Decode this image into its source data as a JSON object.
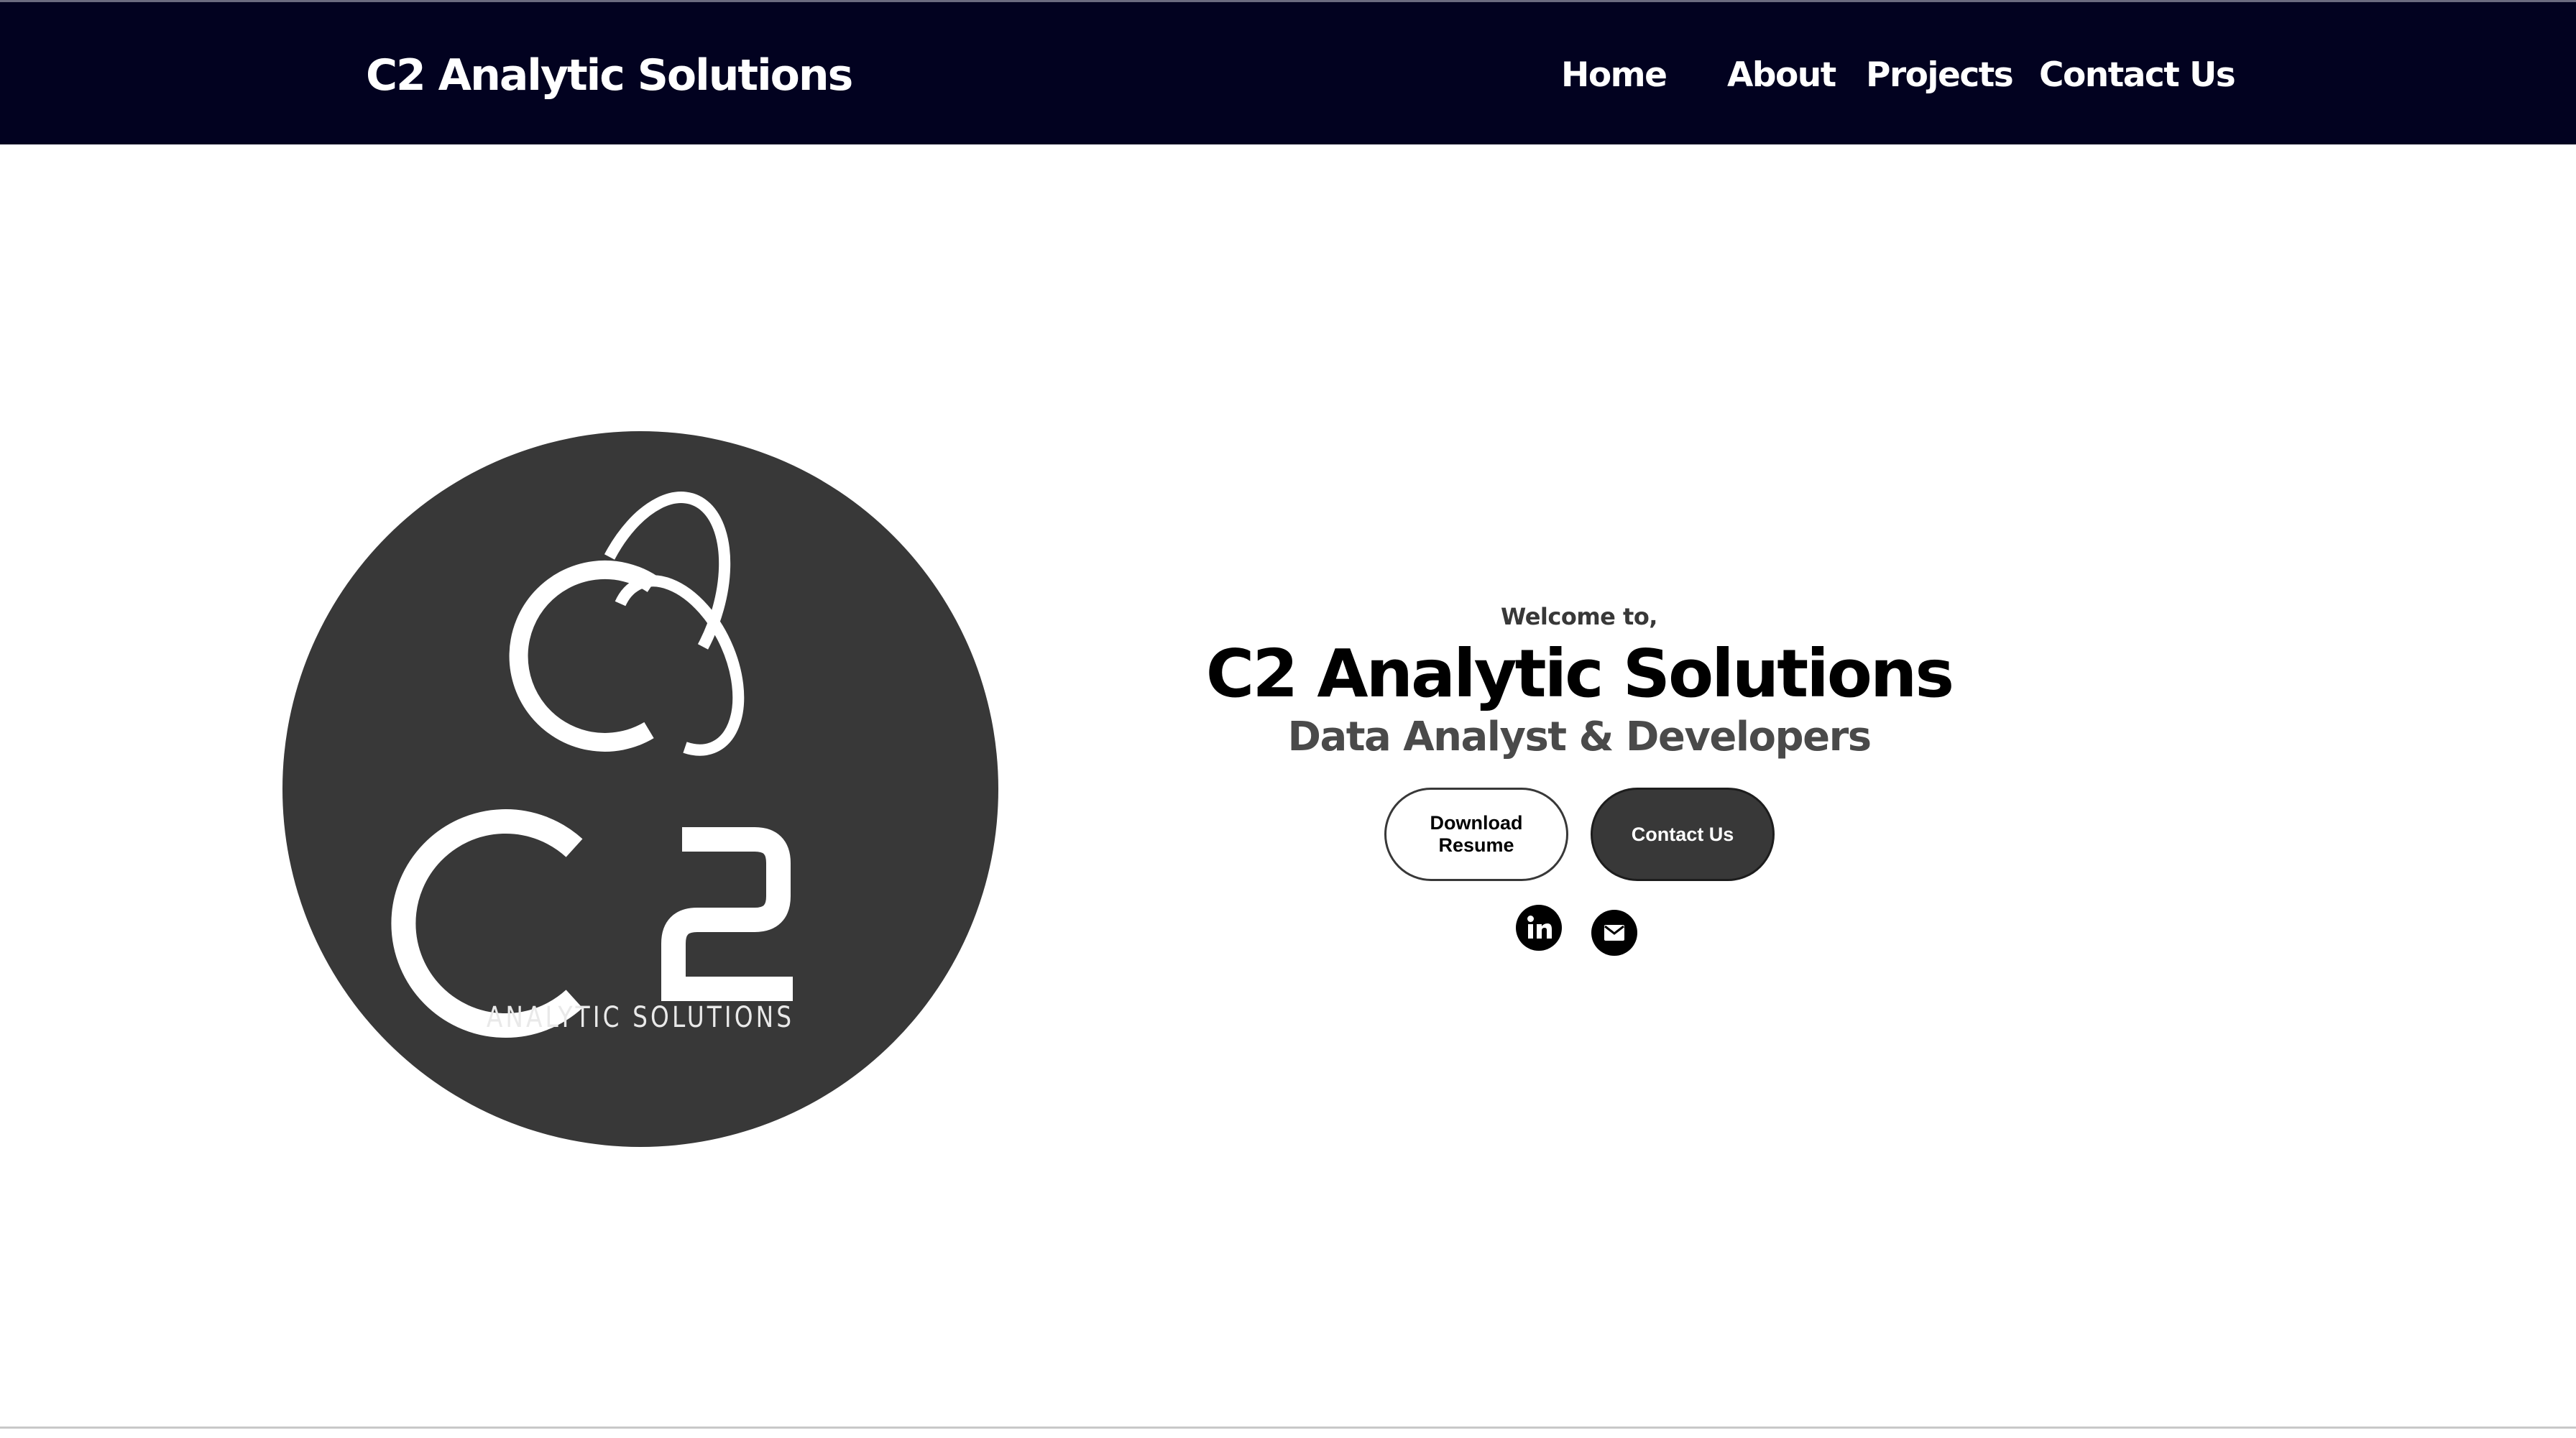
{
  "header": {
    "brand": "C2 Analytic Solutions",
    "nav": [
      {
        "label": "Home"
      },
      {
        "label": "About"
      },
      {
        "label": "Projects"
      },
      {
        "label": "Contact Us"
      }
    ]
  },
  "hero": {
    "logo": {
      "monogram": "C2",
      "caption": "ANALYTIC SOLUTIONS"
    },
    "welcome": "Welcome to,",
    "title": "C2 Analytic Solutions",
    "subtitle": "Data Analyst & Developers",
    "buttons": {
      "resume_label": "Download Resume",
      "contact_label": "Contact Us"
    },
    "social": [
      {
        "icon": "linkedin-icon"
      },
      {
        "icon": "email-icon"
      }
    ]
  },
  "colors": {
    "navbar": "#020220",
    "logo_circle": "#383838",
    "text_primary": "#000000",
    "text_secondary": "#4a4a4a",
    "button_dark": "#383838"
  }
}
